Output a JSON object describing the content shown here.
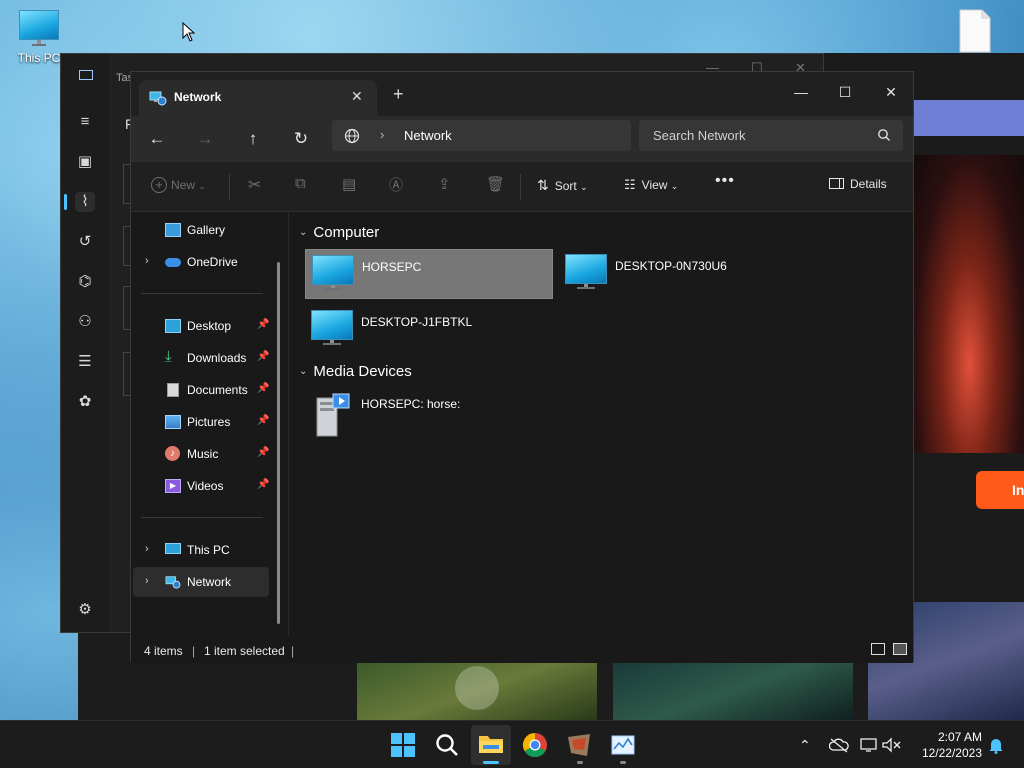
{
  "desktop": {
    "this_pc_label": "This PC"
  },
  "task_manager": {
    "title_fragment": "Tas",
    "header_letter": "F"
  },
  "background_browser": {
    "button_fragment": "In"
  },
  "explorer": {
    "tab_title": "Network",
    "address": "Network",
    "search_placeholder": "Search Network",
    "toolbar": {
      "new_label": "New",
      "sort_label": "Sort",
      "view_label": "View",
      "details_label": "Details"
    },
    "nav": {
      "gallery": "Gallery",
      "onedrive": "OneDrive",
      "desktop": "Desktop",
      "downloads": "Downloads",
      "documents": "Documents",
      "pictures": "Pictures",
      "music": "Music",
      "videos": "Videos",
      "this_pc": "This PC",
      "network": "Network"
    },
    "groups": {
      "computer": "Computer",
      "media": "Media Devices"
    },
    "items": {
      "horsepc": "HORSEPC",
      "desktop_0n": "DESKTOP-0N730U6",
      "desktop_j1": "DESKTOP-J1FBTKL",
      "media_horse": "HORSEPC: horse:"
    },
    "status": {
      "count": "4 items",
      "selected": "1 item selected"
    }
  },
  "taskbar": {
    "time": "2:07 AM",
    "date": "12/22/2023"
  },
  "colors": {
    "accent": "#4cc2ff",
    "window_bg": "#191919",
    "selection": "#777777"
  }
}
